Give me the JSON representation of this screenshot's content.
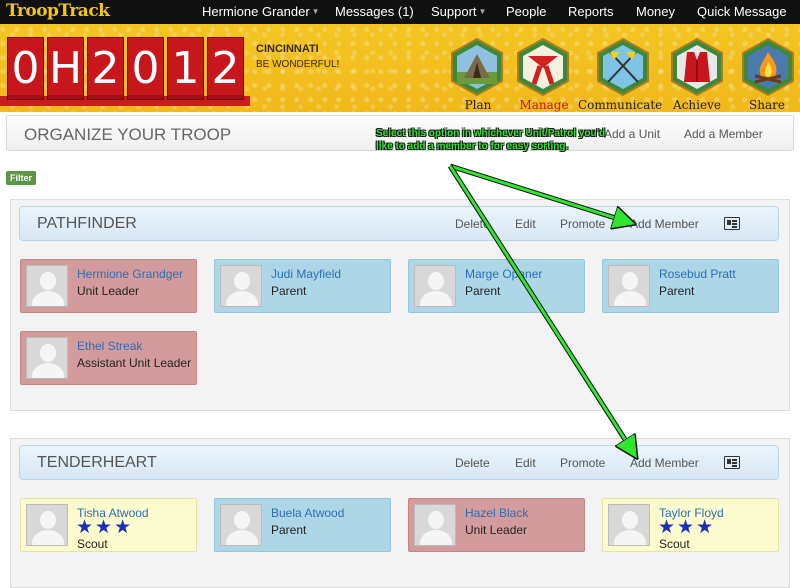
{
  "nav": {
    "brand": "TroopTrack",
    "user": "Hermione Grander",
    "messages": "Messages (1)",
    "support": "Support",
    "people": "People",
    "reports": "Reports",
    "money": "Money",
    "quick_message": "Quick Message"
  },
  "banner": {
    "digits": [
      "0",
      "H",
      "2",
      "0",
      "1",
      "2"
    ],
    "city": "CINCINNATI",
    "tagline": "BE WONDERFUL!",
    "badges": [
      "Plan",
      "Manage",
      "Communicate",
      "Achieve",
      "Share"
    ],
    "badge_icons": [
      "tent-badge-icon",
      "scarf-badge-icon",
      "flags-badge-icon",
      "vest-badge-icon",
      "campfire-badge-icon"
    ]
  },
  "organize": {
    "title": "ORGANIZE YOUR TROOP",
    "add_unit": "Add a Unit",
    "add_member": "Add a Member"
  },
  "filter_label": "Filter",
  "annotation": "Select this option in whichever Unit/Patrol you'd like to add a member to for easy sorting.",
  "units": [
    {
      "name": "PATHFINDER",
      "actions": {
        "delete": "Delete",
        "edit": "Edit",
        "promote": "Promote",
        "add_member": "Add Member"
      },
      "members": [
        {
          "name": "Hermione Grandger",
          "role": "Unit Leader",
          "type": "leader"
        },
        {
          "name": "Judi Mayfield",
          "role": "Parent",
          "type": "parent"
        },
        {
          "name": "Marge Opaner",
          "role": "Parent",
          "type": "parent"
        },
        {
          "name": "Rosebud Pratt",
          "role": "Parent",
          "type": "parent"
        },
        {
          "name": "Ethel Streak",
          "role": "Assistant Unit Leader",
          "type": "leader"
        }
      ]
    },
    {
      "name": "TENDERHEART",
      "actions": {
        "delete": "Delete",
        "edit": "Edit",
        "promote": "Promote",
        "add_member": "Add Member"
      },
      "members": [
        {
          "name": "Tisha Atwood",
          "role": "Scout",
          "type": "scout",
          "stars": 3
        },
        {
          "name": "Buela Atwood",
          "role": "Parent",
          "type": "parent"
        },
        {
          "name": "Hazel Black",
          "role": "Unit Leader",
          "type": "leader"
        },
        {
          "name": "Taylor Floyd",
          "role": "Scout",
          "type": "scout",
          "stars": 3
        }
      ]
    }
  ],
  "colors": {
    "leader_card": "#d39b9b",
    "parent_card": "#add7e7",
    "scout_card": "#fcfbce",
    "annotation": "#2ee62e",
    "banner": "#f3c522",
    "counter": "#c8161d"
  }
}
